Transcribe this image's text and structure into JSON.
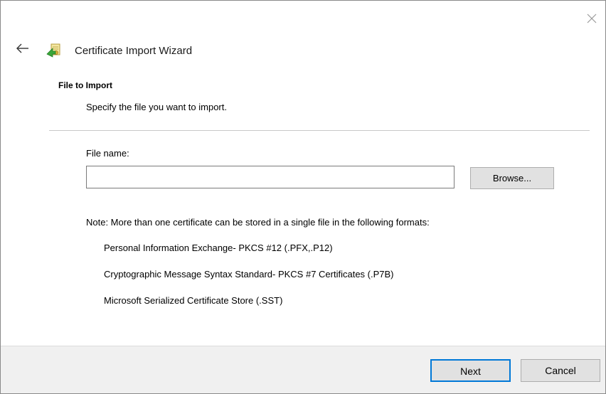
{
  "window": {
    "close_icon": "close-icon"
  },
  "header": {
    "back_icon": "back-arrow-icon",
    "wizard_icon": "certificate-wizard-icon",
    "title": "Certificate Import Wizard"
  },
  "section": {
    "title": "File to Import",
    "subtitle": "Specify the file you want to import."
  },
  "file": {
    "label": "File name:",
    "value": "",
    "browse_label": "Browse..."
  },
  "note": {
    "text": "Note:  More than one certificate can be stored in a single file in the following formats:",
    "formats": [
      "Personal Information Exchange- PKCS #12 (.PFX,.P12)",
      "Cryptographic Message Syntax Standard- PKCS #7 Certificates (.P7B)",
      "Microsoft Serialized Certificate Store (.SST)"
    ]
  },
  "footer": {
    "next_label": "Next",
    "cancel_label": "Cancel"
  },
  "colors": {
    "focus_border": "#0078d7",
    "button_bg": "#e1e1e1",
    "footer_bg": "#f0f0f0"
  }
}
